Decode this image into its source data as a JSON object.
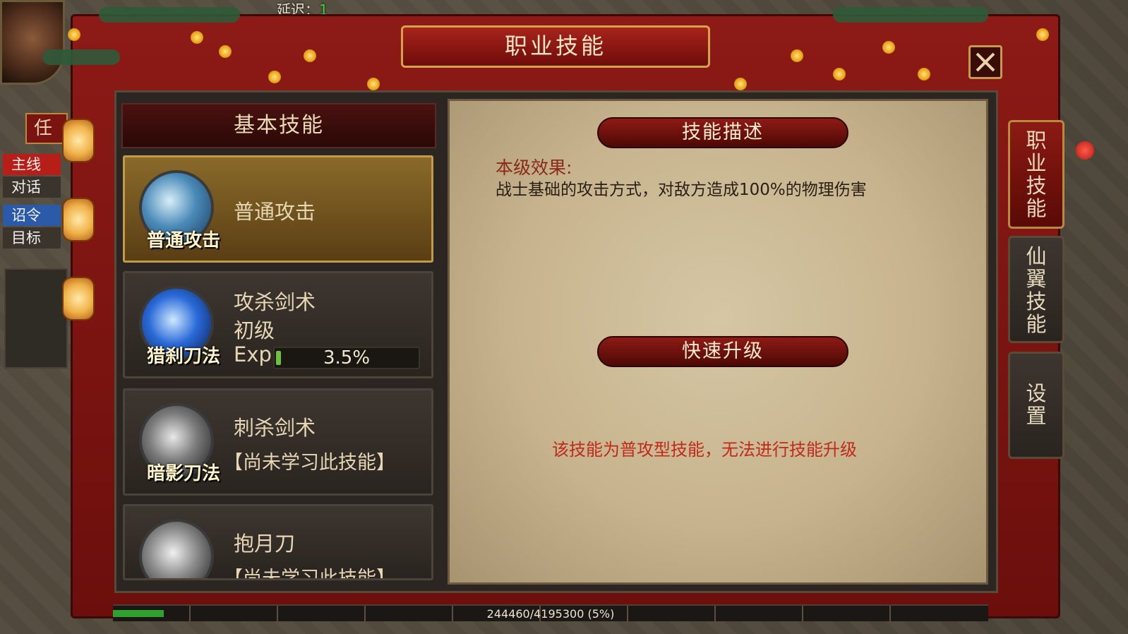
{
  "hud": {
    "latency_label": "延迟：",
    "latency_value": "1"
  },
  "task_panel": {
    "tab_partial": "任",
    "items": [
      "主线",
      "对话",
      "诏令",
      "目标"
    ]
  },
  "window": {
    "title": "职业技能"
  },
  "skill_list": {
    "header": "基本技能",
    "skills": [
      {
        "icon_caption": "普通攻击",
        "name": "普通攻击",
        "status": "",
        "icon": "sword-slash-icon"
      },
      {
        "icon_caption": "猎刹刀法",
        "name": "攻杀剑术",
        "level": "初级",
        "exp_label": "Exp",
        "exp_text": "3.5%",
        "exp_fraction": 0.035,
        "icon": "blue-blade-icon"
      },
      {
        "icon_caption": "暗影刀法",
        "name": "刺杀剑术",
        "status": "【尚未学习此技能】",
        "icon": "shadow-blade-icon"
      },
      {
        "icon_caption": "",
        "name": "抱月刀",
        "status": "【尚未学习此技能】",
        "icon": "crescent-moon-icon"
      }
    ]
  },
  "detail": {
    "description_banner": "技能描述",
    "effect_label": "本级效果:",
    "effect_text": "战士基础的攻击方式，对敌方造成100%的物理伤害",
    "upgrade_banner": "快速升级",
    "upgrade_notice": "该技能为普攻型技能，无法进行技能升级"
  },
  "side_tabs": {
    "tab1": "职业技能",
    "tab2": "仙翼技能",
    "tab3": "设置"
  },
  "bottom": {
    "exp_text": "244460/4195300 (5%)",
    "exp_fraction": 0.058
  },
  "colors": {
    "frame_red": "#8d1a16",
    "gold": "#c29a4a",
    "notice_red": "#c02a1a",
    "exp_green": "#6ec23a"
  }
}
